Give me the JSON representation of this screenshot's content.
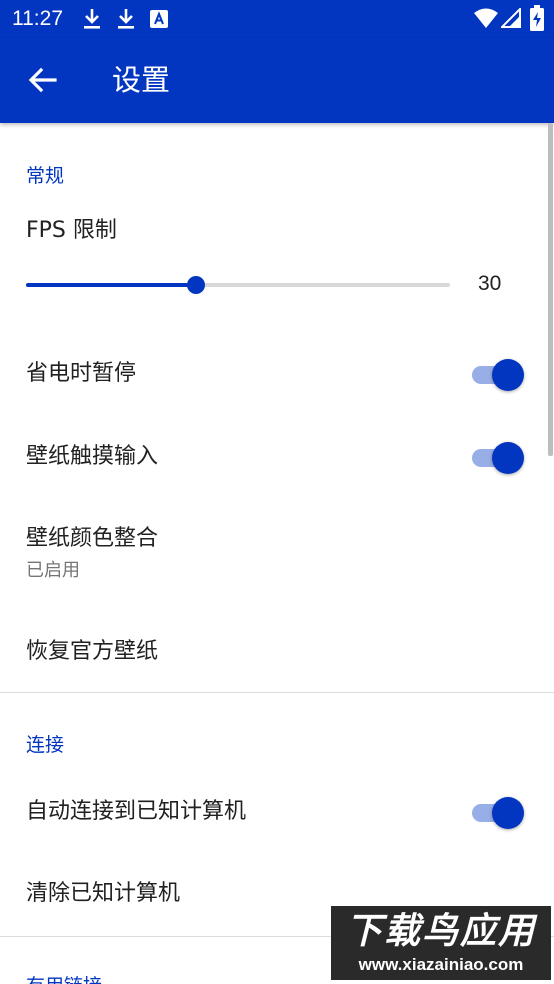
{
  "status_bar": {
    "time": "11:27",
    "icons": [
      "download-icon",
      "download-icon",
      "font-a-icon",
      "wifi-icon",
      "signal-icon",
      "battery-charging-icon"
    ]
  },
  "app_bar": {
    "title": "设置",
    "back_icon": "arrow-left-icon"
  },
  "sections": {
    "general": {
      "header": "常规",
      "fps": {
        "title": "FPS 限制",
        "value": "30",
        "fraction": 0.4
      },
      "pause_on_battery_saver": {
        "title": "省电时暂停",
        "enabled": true
      },
      "wallpaper_touch_input": {
        "title": "壁纸触摸输入",
        "enabled": true
      },
      "wallpaper_color_integration": {
        "title": "壁纸颜色整合",
        "summary": "已启用"
      },
      "restore_official_wallpaper": {
        "title": "恢复官方壁纸"
      }
    },
    "connection": {
      "header": "连接",
      "auto_connect": {
        "title": "自动连接到已知计算机",
        "enabled": true
      },
      "clear_known": {
        "title": "清除已知计算机"
      }
    },
    "links": {
      "header": "有用链接"
    }
  },
  "watermark": {
    "title": "下载鸟应用",
    "url": "www.xiazainiao.com"
  },
  "colors": {
    "primary": "#0236c0",
    "toggle_track": "#98aee6",
    "slider_inactive": "#d8d8d8",
    "text_primary": "#212121",
    "text_secondary": "#757575",
    "divider": "#dcdcdc"
  }
}
